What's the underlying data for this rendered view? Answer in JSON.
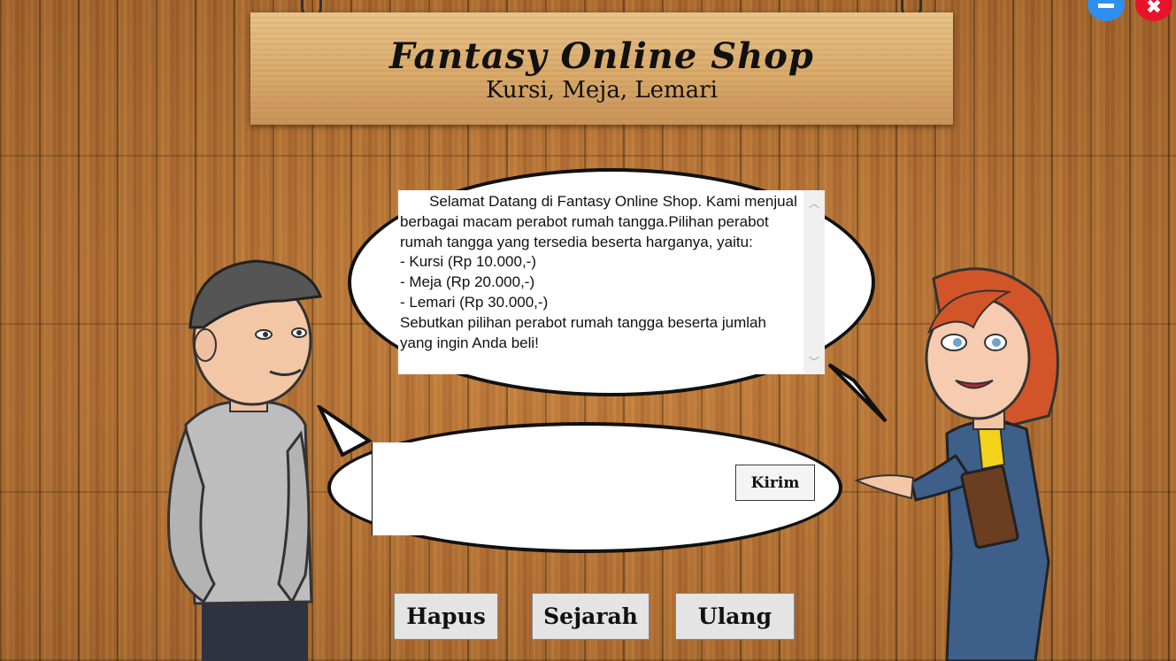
{
  "window": {
    "minimize_label": "minimize",
    "close_label": "✖"
  },
  "sign": {
    "title": "Fantasy Online Shop",
    "subtitle": "Kursi, Meja, Lemari"
  },
  "chat": {
    "message": "       Selamat Datang di Fantasy Online Shop. Kami menjual berbagai macam perabot rumah tangga.Pilihan perabot rumah tangga yang tersedia beserta harganya, yaitu:\n- Kursi (Rp 10.000,-)\n- Meja (Rp 20.000,-)\n- Lemari (Rp 30.000,-)\nSebutkan pilihan perabot rumah tangga beserta jumlah yang ingin Anda beli!",
    "input_value": "",
    "send_label": "Kirim"
  },
  "buttons": {
    "hapus": "Hapus",
    "sejarah": "Sejarah",
    "ulang": "Ulang"
  },
  "colors": {
    "wood": "#b56e2e",
    "sign": "#d9aa6a",
    "minimize": "#2e8ff0",
    "close": "#e8122a"
  }
}
